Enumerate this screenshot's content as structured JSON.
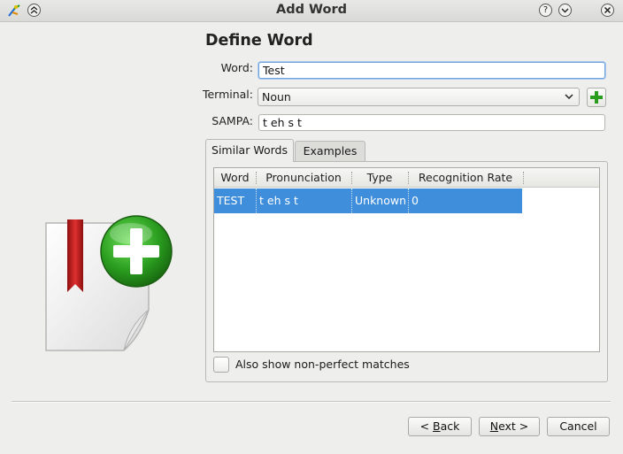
{
  "window": {
    "title": "Add Word",
    "buttons": {
      "help": "?",
      "minimize": "⌄",
      "close": "✕",
      "shade": "⌃"
    }
  },
  "page": {
    "heading": "Define Word"
  },
  "form": {
    "word_label": "Word:",
    "word_value": "Test",
    "terminal_label": "Terminal:",
    "terminal_value": "Noun",
    "sampa_label": "SAMPA:",
    "sampa_value": "t eh s t"
  },
  "tabs": [
    {
      "label": "Similar Words",
      "active": true
    },
    {
      "label": "Examples",
      "active": false
    }
  ],
  "table": {
    "columns": [
      "Word",
      "Pronunciation",
      "Type",
      "Recognition Rate"
    ],
    "rows": [
      {
        "word": "TEST",
        "pronunciation": "t eh s t",
        "type": "Unknown",
        "rate": "0",
        "selected": true
      }
    ]
  },
  "checkbox": {
    "label": "Also show non-perfect matches",
    "checked": false
  },
  "footer": {
    "back_prefix": "< ",
    "back_mnemonic": "B",
    "back_rest": "ack",
    "next_mnemonic": "N",
    "next_rest": "ext >",
    "cancel": "Cancel"
  },
  "colors": {
    "selection": "#3f8edb",
    "accent_green": "#2a9d1f",
    "bookmark_red": "#c81e1e"
  },
  "icons": [
    "app-icon",
    "shade-up-icon",
    "help-icon",
    "minimize-icon",
    "close-icon",
    "add-icon",
    "dropdown-arrow-icon",
    "add-word-illustration-icon"
  ]
}
